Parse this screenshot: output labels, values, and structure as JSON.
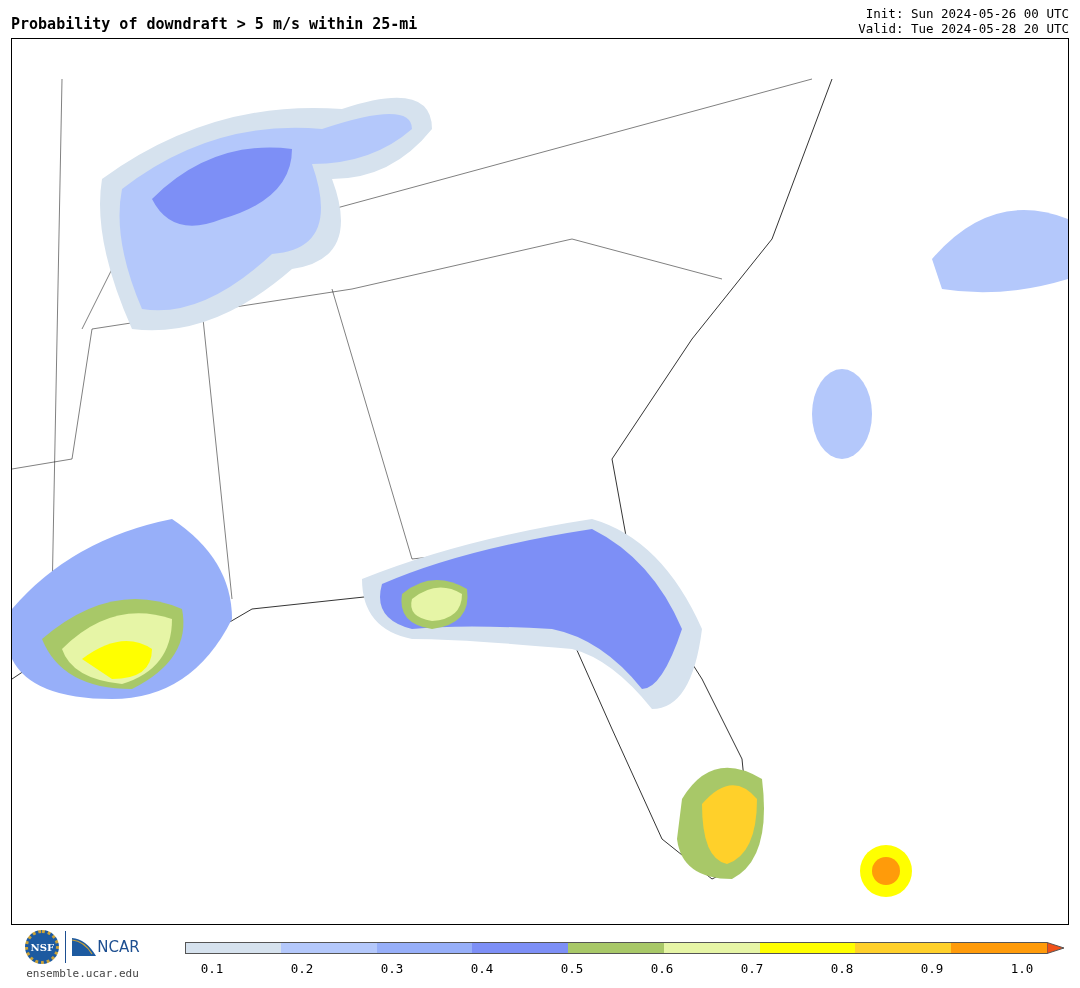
{
  "header": {
    "title": "Probability of downdraft > 5 m/s within 25-mi",
    "init": "Init: Sun 2024-05-26 00 UTC",
    "valid": "Valid: Tue 2024-05-28 20 UTC"
  },
  "logo": {
    "seal_text": "NSF",
    "org_text": "NCAR",
    "url": "ensemble.ucar.edu"
  },
  "colorbar": {
    "bins": [
      {
        "kind": "bin",
        "color": "#d6e2ee"
      },
      {
        "kind": "bin",
        "color": "#b4c8fb"
      },
      {
        "kind": "bin",
        "color": "#97aff9"
      },
      {
        "kind": "bin",
        "color": "#7d8ff6"
      },
      {
        "kind": "bin",
        "color": "#a8c868"
      },
      {
        "kind": "bin",
        "color": "#e6f5a6"
      },
      {
        "kind": "bin",
        "color": "#ffff00"
      },
      {
        "kind": "bin",
        "color": "#ffd02a"
      },
      {
        "kind": "bin",
        "color": "#ff9b0a"
      },
      {
        "kind": "arrow",
        "color": "#f05018"
      }
    ],
    "ticks": [
      "0.1",
      "0.2",
      "0.3",
      "0.4",
      "0.5",
      "0.6",
      "0.7",
      "0.8",
      "0.9",
      "1.0"
    ]
  }
}
